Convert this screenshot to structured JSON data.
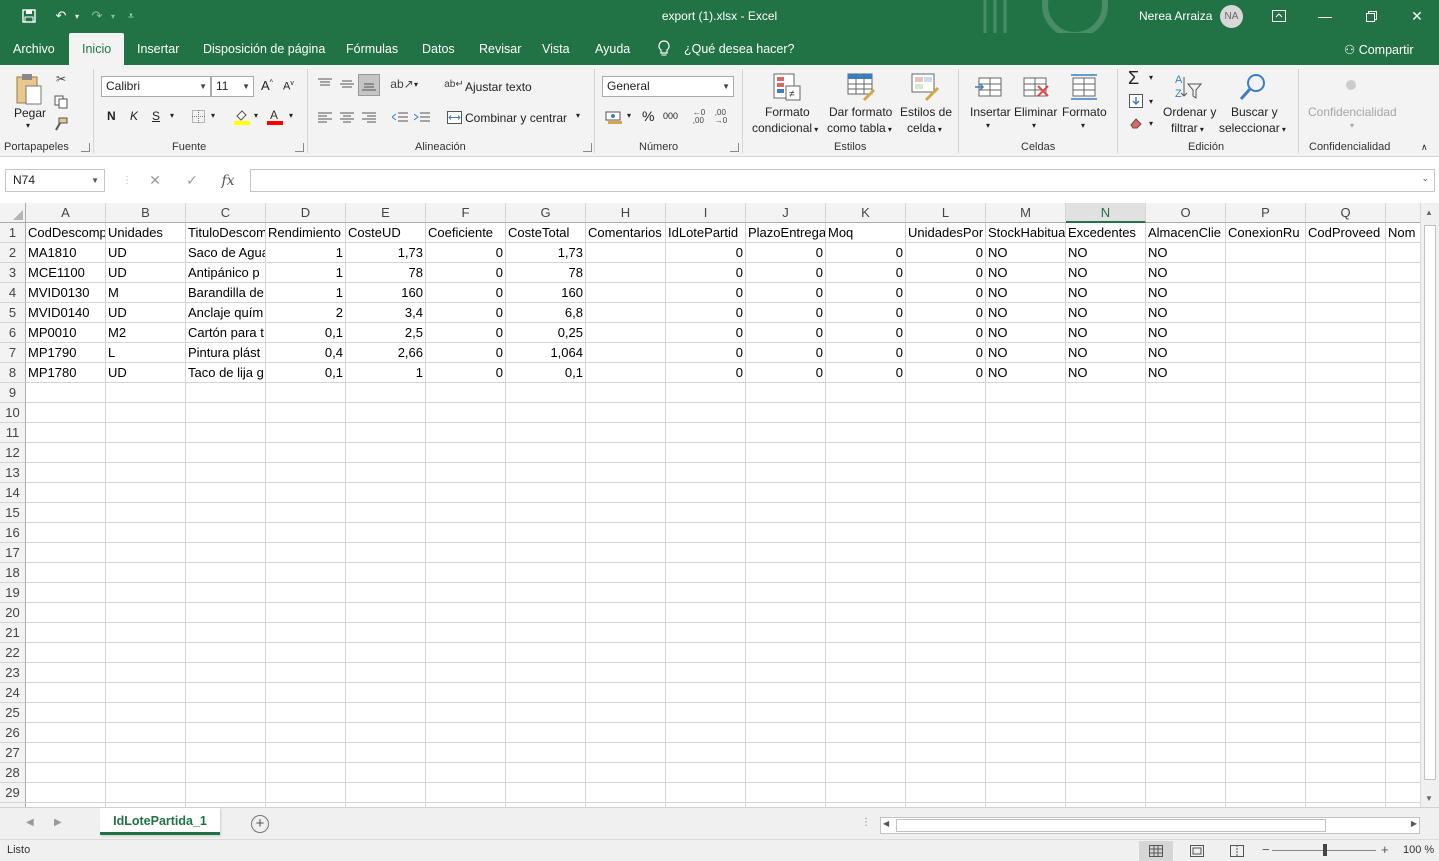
{
  "window": {
    "title": "export (1).xlsx  -  Excel",
    "user": "Nerea Arraiza",
    "user_initials": "NA"
  },
  "menu": {
    "tabs": [
      "Archivo",
      "Inicio",
      "Insertar",
      "Disposición de página",
      "Fórmulas",
      "Datos",
      "Revisar",
      "Vista",
      "Ayuda"
    ],
    "active_tab": "Inicio",
    "tell_me": "¿Qué desea hacer?",
    "share": "Compartir"
  },
  "ribbon": {
    "clipboard": {
      "paste": "Pegar",
      "label": "Portapapeles"
    },
    "font": {
      "name": "Calibri",
      "size": "11",
      "bold": "N",
      "italic": "K",
      "underline": "S",
      "label": "Fuente"
    },
    "alignment": {
      "wrap": "Ajustar texto",
      "merge": "Combinar y centrar",
      "label": "Alineación"
    },
    "number": {
      "format": "General",
      "percent": "%",
      "thousands": "000",
      "label": "Número"
    },
    "styles": {
      "conditional": [
        "Formato",
        "condicional"
      ],
      "as_table": [
        "Dar formato",
        "como tabla"
      ],
      "cell_styles": [
        "Estilos de",
        "celda"
      ],
      "label": "Estilos"
    },
    "cells": {
      "insert": "Insertar",
      "delete": "Eliminar",
      "format": "Formato",
      "label": "Celdas"
    },
    "editing": {
      "sort": [
        "Ordenar y",
        "filtrar"
      ],
      "find": [
        "Buscar y",
        "seleccionar"
      ],
      "label": "Edición"
    },
    "confidentiality": {
      "button": "Confidencialidad",
      "label": "Confidencialidad"
    }
  },
  "formula_bar": {
    "name_box": "N74",
    "fx": "fx",
    "value": ""
  },
  "sheet": {
    "selected_column": "N",
    "columns": [
      "A",
      "B",
      "C",
      "D",
      "E",
      "F",
      "G",
      "H",
      "I",
      "J",
      "K",
      "L",
      "M",
      "N",
      "O",
      "P",
      "Q"
    ],
    "rows": [
      [
        "CodDescomp",
        "Unidades",
        "TituloDescom",
        "Rendimiento",
        "CosteUD",
        "Coeficiente",
        "CosteTotal",
        "Comentarios",
        "IdLotePartid",
        "PlazoEntrega",
        "Moq",
        "UnidadesPor",
        "StockHabitua",
        "Excedentes",
        "AlmacenClie",
        "ConexionRu",
        "CodProveed",
        "Nom"
      ],
      [
        "MA1810",
        "UD",
        "Saco de Agua",
        "1",
        "1,73",
        "0",
        "1,73",
        "",
        "0",
        "0",
        "0",
        "0",
        "NO",
        "NO",
        "NO",
        "",
        "",
        ""
      ],
      [
        "MCE1100",
        "UD",
        "Antipánico p",
        "1",
        "78",
        "0",
        "78",
        "",
        "0",
        "0",
        "0",
        "0",
        "NO",
        "NO",
        "NO",
        "",
        "",
        ""
      ],
      [
        "MVID0130",
        "M",
        "Barandilla de",
        "1",
        "160",
        "0",
        "160",
        "",
        "0",
        "0",
        "0",
        "0",
        "NO",
        "NO",
        "NO",
        "",
        "",
        ""
      ],
      [
        "MVID0140",
        "UD",
        "Anclaje quím",
        "2",
        "3,4",
        "0",
        "6,8",
        "",
        "0",
        "0",
        "0",
        "0",
        "NO",
        "NO",
        "NO",
        "",
        "",
        ""
      ],
      [
        "MP0010",
        "M2",
        "Cartón para t",
        "0,1",
        "2,5",
        "0",
        "0,25",
        "",
        "0",
        "0",
        "0",
        "0",
        "NO",
        "NO",
        "NO",
        "",
        "",
        ""
      ],
      [
        "MP1790",
        "L",
        "Pintura plást",
        "0,4",
        "2,66",
        "0",
        "1,064",
        "",
        "0",
        "0",
        "0",
        "0",
        "NO",
        "NO",
        "NO",
        "",
        "",
        ""
      ],
      [
        "MP1780",
        "UD",
        "Taco de lija g",
        "0,1",
        "1",
        "0",
        "0,1",
        "",
        "0",
        "0",
        "0",
        "0",
        "NO",
        "NO",
        "NO",
        "",
        "",
        ""
      ]
    ],
    "numeric_columns": [
      3,
      4,
      5,
      6,
      8,
      9,
      10,
      11
    ],
    "row_count": 29
  },
  "sheet_tabs": {
    "tabs": [
      "IdLotePartida_1"
    ],
    "active": "IdLotePartida_1"
  },
  "status": {
    "mode": "Listo",
    "zoom": "100 %"
  },
  "colors": {
    "accent": "#217346",
    "ribbon_bg": "#f3f3f3",
    "grid_line": "#d4d4d4"
  }
}
